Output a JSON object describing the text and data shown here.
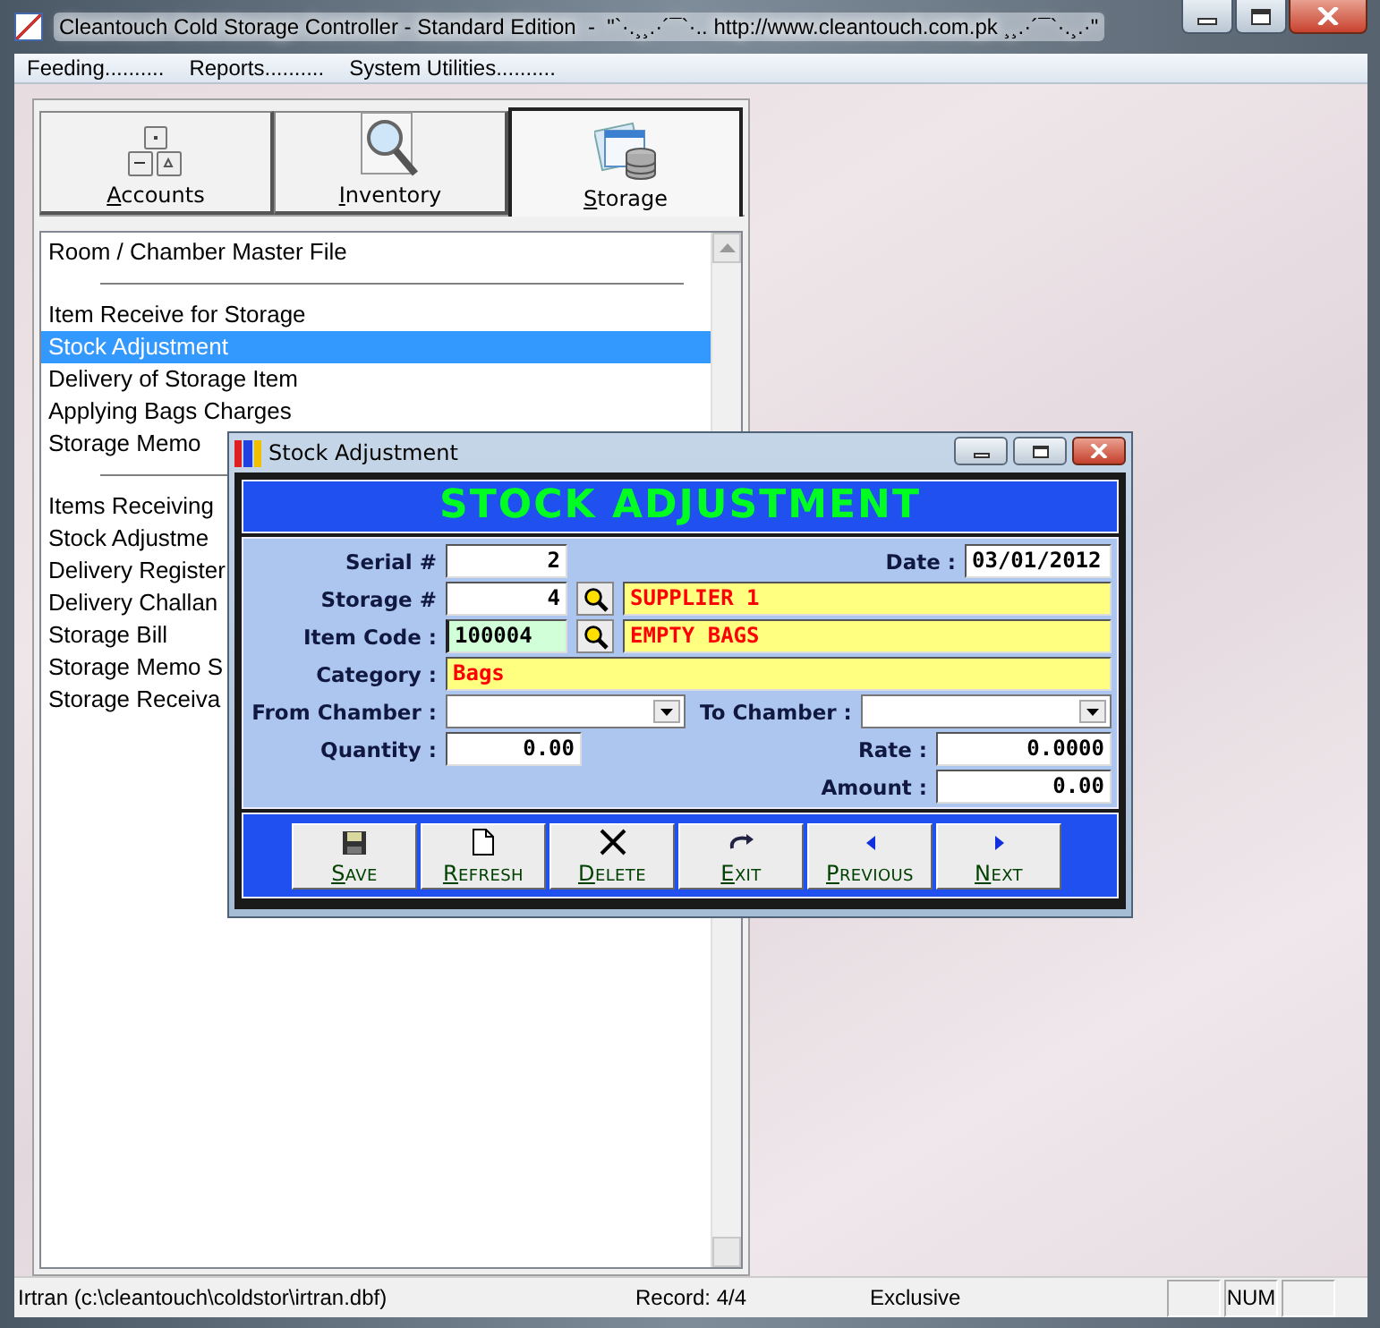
{
  "window": {
    "title": "Cleantouch Cold Storage Controller - Standard Edition  -  \"`·.¸¸.·´¯`·.. http://www.cleantouch.com.pk ¸¸.·´¯`·.¸.·\""
  },
  "menu": [
    "Feeding..........",
    "Reports..........",
    "System Utilities.........."
  ],
  "tabs": [
    {
      "label": "Accounts",
      "kind": "keys",
      "selected": false
    },
    {
      "label": "Inventory",
      "kind": "magnifier",
      "selected": false
    },
    {
      "label": "Storage",
      "kind": "database",
      "selected": true
    }
  ],
  "list_groups": [
    [
      {
        "label": "Room / Chamber Master File",
        "selected": false
      }
    ],
    [
      {
        "label": "Item Receive for Storage",
        "selected": false
      },
      {
        "label": "Stock Adjustment",
        "selected": true
      },
      {
        "label": "Delivery of Storage Item",
        "selected": false
      },
      {
        "label": "Applying Bags Charges",
        "selected": false
      },
      {
        "label": "Storage Memo",
        "selected": false
      }
    ],
    [
      {
        "label": "Items Receiving",
        "selected": false
      },
      {
        "label": "Stock Adjustme",
        "selected": false
      },
      {
        "label": "Delivery Register",
        "selected": false
      },
      {
        "label": "Delivery Challan",
        "selected": false
      },
      {
        "label": "Storage Bill",
        "selected": false
      },
      {
        "label": "Storage Memo S",
        "selected": false
      },
      {
        "label": "Storage Receiva",
        "selected": false
      }
    ]
  ],
  "dialog": {
    "title": "Stock Adjustment",
    "heading": "STOCK ADJUSTMENT",
    "serial": {
      "label": "Serial #",
      "value": "2"
    },
    "date": {
      "label": "Date :",
      "value": "03/01/2012"
    },
    "storage": {
      "label": "Storage #",
      "value": "4",
      "name": "SUPPLIER 1"
    },
    "item_code": {
      "label": "Item Code :",
      "value": "100004",
      "name": "EMPTY BAGS"
    },
    "category": {
      "label": "Category :",
      "value": "Bags"
    },
    "from_chamber": {
      "label": "From Chamber :"
    },
    "to_chamber": {
      "label": "To Chamber :"
    },
    "quantity": {
      "label": "Quantity :",
      "value": "0.00"
    },
    "rate": {
      "label": "Rate :",
      "value": "0.0000"
    },
    "amount": {
      "label": "Amount :",
      "value": "0.00"
    },
    "buttons": [
      {
        "label": "SAVE",
        "kind": "save"
      },
      {
        "label": "REFRESH",
        "kind": "refresh"
      },
      {
        "label": "DELETE",
        "kind": "delete"
      },
      {
        "label": "EXIT",
        "kind": "exit"
      },
      {
        "label": "PREVIOUS",
        "kind": "previous"
      },
      {
        "label": "NEXT",
        "kind": "next"
      }
    ]
  },
  "status_bar": {
    "file": "Irtran (c:\\cleantouch\\coldstor\\irtran.dbf)",
    "record": "Record: 4/4",
    "mode": "Exclusive",
    "indicators": [
      "NUM"
    ]
  }
}
